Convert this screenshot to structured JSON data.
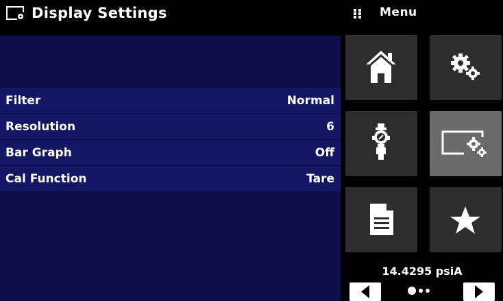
{
  "header": {
    "title": "Display Settings",
    "title_icon": "display-settings-icon",
    "menu_label": "Menu",
    "menu_icon": "grid-dots-icon"
  },
  "settings": [
    {
      "label": "Filter",
      "value": "Normal"
    },
    {
      "label": "Resolution",
      "value": "6"
    },
    {
      "label": "Bar Graph",
      "value": "Off"
    },
    {
      "label": "Cal Function",
      "value": "Tare"
    }
  ],
  "menu_tiles": [
    {
      "icon": "home-icon",
      "active": false
    },
    {
      "icon": "gears-icon",
      "active": false
    },
    {
      "icon": "pressure-sensor-icon",
      "active": false
    },
    {
      "icon": "display-settings-icon",
      "active": true
    },
    {
      "icon": "document-icon",
      "active": false
    },
    {
      "icon": "star-icon",
      "active": false
    }
  ],
  "footer": {
    "reading": "14.4295 psiA",
    "prev_icon": "arrow-left-icon",
    "next_icon": "arrow-right-icon",
    "page_index": 1,
    "page_count": 3
  },
  "colors": {
    "panel_bg": "#0e0f4a",
    "row_bg": "#141663",
    "tile_bg": "#2d2d2d",
    "tile_active_bg": "#6a6a6a"
  }
}
